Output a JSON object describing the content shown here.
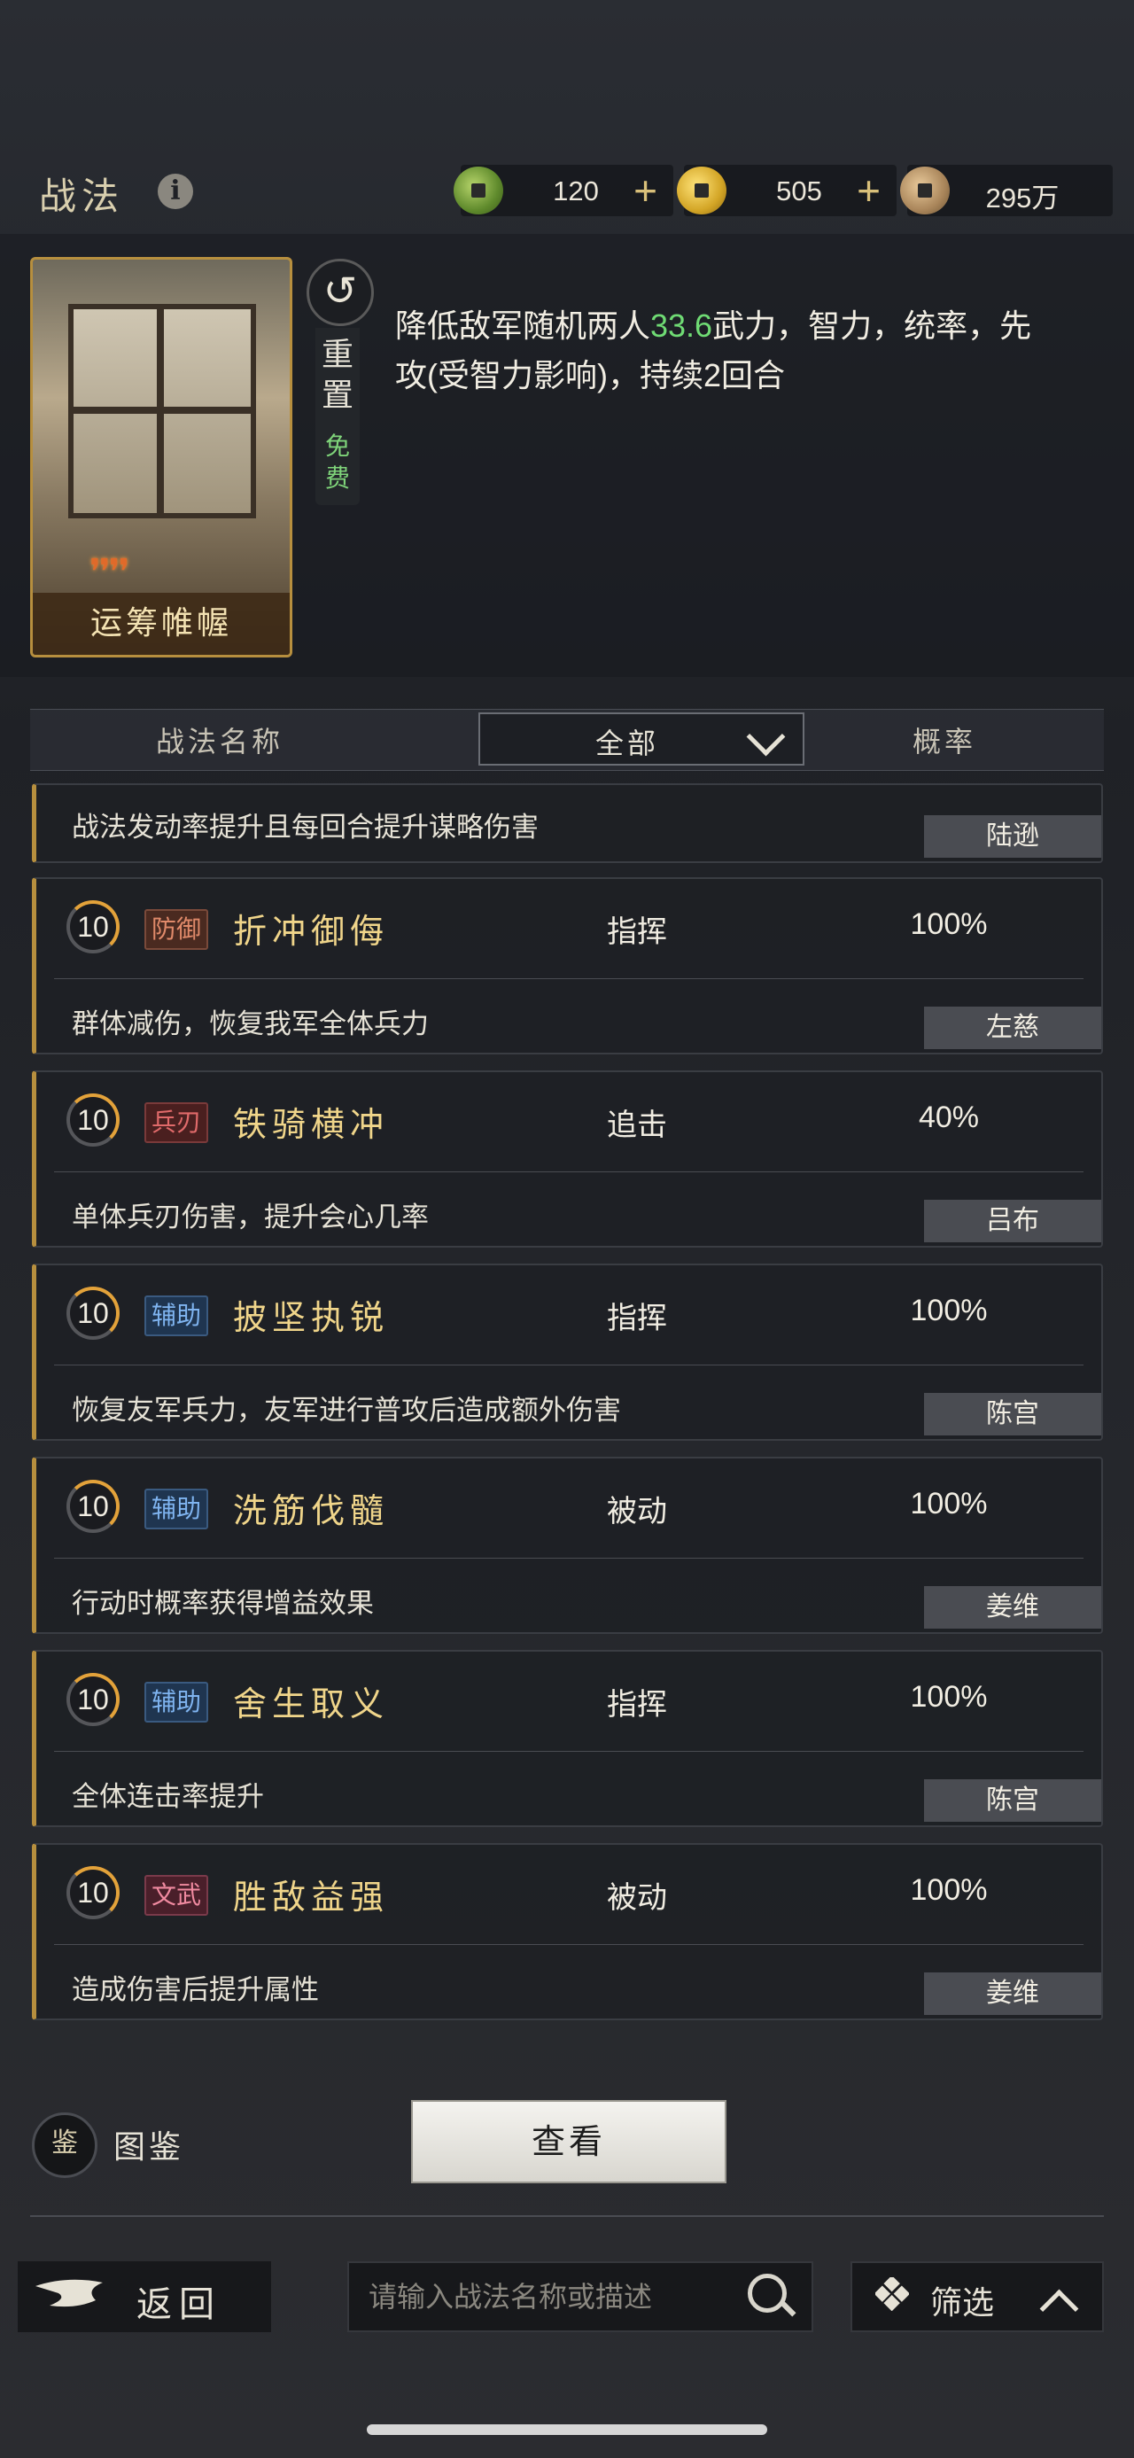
{
  "header": {
    "title": "战法",
    "info_icon": "info-icon"
  },
  "resources": [
    {
      "icon": "jade-coin-icon",
      "value": "120",
      "has_plus": true
    },
    {
      "icon": "gold-coin-icon",
      "value": "505",
      "has_plus": true
    },
    {
      "icon": "copper-coin-icon",
      "value": "295万",
      "has_plus": false
    }
  ],
  "selected_skill": {
    "card_name": "运筹帷幄",
    "stars": "❜❜❜❜",
    "reset_label": "重置",
    "free_label": "免费",
    "description_pre": "降低敌军随机两人",
    "description_value": "33.6",
    "description_post": "武力，智力，统率，先攻(受智力影响)，持续2回合"
  },
  "table_header": {
    "name_col": "战法名称",
    "filter_value": "全部",
    "prob_col": "概率"
  },
  "partial_row": {
    "desc": "战法发动率提升且每回合提升谋略伤害",
    "owner": "陆逊"
  },
  "skills": [
    {
      "level": "10",
      "tag": "防御",
      "name": "折冲御侮",
      "type": "指挥",
      "prob": "100%",
      "desc": "群体减伤，恢复我军全体兵力",
      "owner": "左慈"
    },
    {
      "level": "10",
      "tag": "兵刃",
      "name": "铁骑横冲",
      "type": "追击",
      "prob": "40%",
      "desc": "单体兵刃伤害，提升会心几率",
      "owner": "吕布"
    },
    {
      "level": "10",
      "tag": "辅助",
      "name": "披坚执锐",
      "type": "指挥",
      "prob": "100%",
      "desc": "恢复友军兵力，友军进行普攻后造成额外伤害",
      "owner": "陈宫"
    },
    {
      "level": "10",
      "tag": "辅助",
      "name": "洗筋伐髓",
      "type": "被动",
      "prob": "100%",
      "desc": "行动时概率获得增益效果",
      "owner": "姜维"
    },
    {
      "level": "10",
      "tag": "辅助",
      "name": "舍生取义",
      "type": "指挥",
      "prob": "100%",
      "desc": "全体连击率提升",
      "owner": "陈宫"
    },
    {
      "level": "10",
      "tag": "文武",
      "name": "胜敌益强",
      "type": "被动",
      "prob": "100%",
      "desc": "造成伤害后提升属性",
      "owner": "姜维"
    }
  ],
  "footer": {
    "encyclopedia_icon": "鉴",
    "encyclopedia_label": "图鉴",
    "view_button": "查看",
    "back_label": "返回",
    "search_placeholder": "请输入战法名称或描述",
    "filter_label": "筛选"
  }
}
